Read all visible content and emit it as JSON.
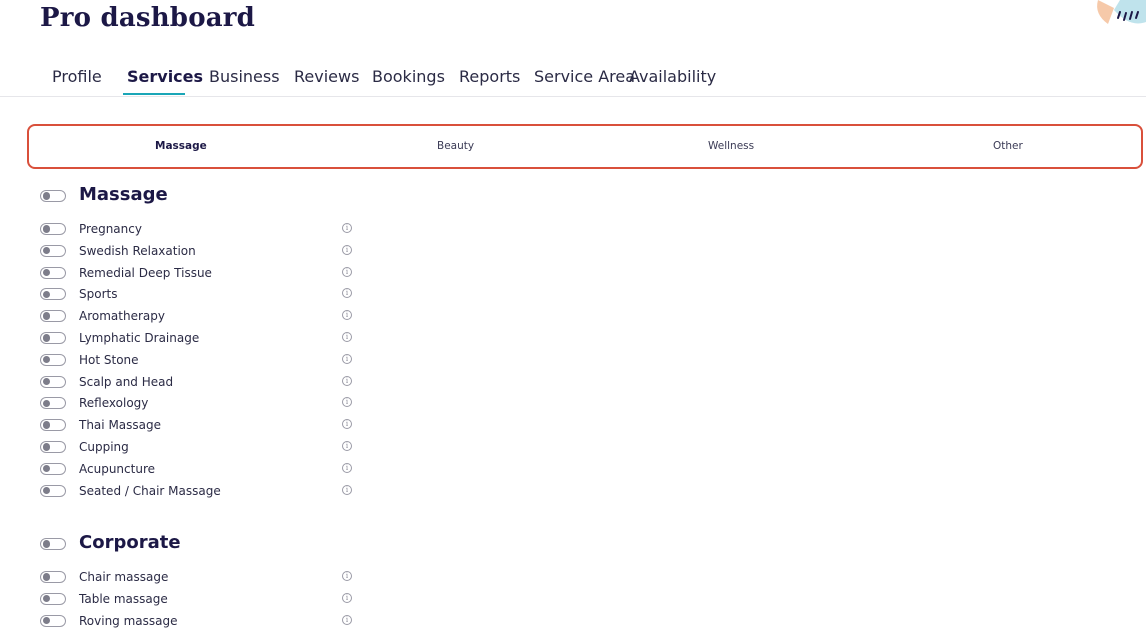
{
  "header": {
    "title": "Pro dashboard"
  },
  "nav": {
    "tabs": [
      {
        "label": "Profile"
      },
      {
        "label": "Services"
      },
      {
        "label": "Business"
      },
      {
        "label": "Reviews"
      },
      {
        "label": "Bookings"
      },
      {
        "label": "Reports"
      },
      {
        "label": "Service Area"
      },
      {
        "label": "Availability"
      }
    ],
    "active": "Services"
  },
  "categories": {
    "tabs": [
      {
        "label": "Massage"
      },
      {
        "label": "Beauty"
      },
      {
        "label": "Wellness"
      },
      {
        "label": "Other"
      }
    ],
    "active": "Massage",
    "highlight_color": "#d9503b"
  },
  "sections": [
    {
      "heading": "Massage",
      "enabled": false,
      "services": [
        {
          "label": "Pregnancy",
          "enabled": false,
          "info_icon": "info-icon"
        },
        {
          "label": "Swedish Relaxation",
          "enabled": false,
          "info_icon": "info-icon"
        },
        {
          "label": "Remedial Deep Tissue",
          "enabled": false,
          "info_icon": "info-icon"
        },
        {
          "label": "Sports",
          "enabled": false,
          "info_icon": "info-icon"
        },
        {
          "label": "Aromatherapy",
          "enabled": false,
          "info_icon": "info-icon"
        },
        {
          "label": "Lymphatic Drainage",
          "enabled": false,
          "info_icon": "info-icon"
        },
        {
          "label": "Hot Stone",
          "enabled": false,
          "info_icon": "info-icon"
        },
        {
          "label": "Scalp and Head",
          "enabled": false,
          "info_icon": "info-icon"
        },
        {
          "label": "Reflexology",
          "enabled": false,
          "info_icon": "info-icon"
        },
        {
          "label": "Thai Massage",
          "enabled": false,
          "info_icon": "info-icon"
        },
        {
          "label": "Cupping",
          "enabled": false,
          "info_icon": "info-icon"
        },
        {
          "label": "Acupuncture",
          "enabled": false,
          "info_icon": "info-icon"
        },
        {
          "label": "Seated / Chair Massage",
          "enabled": false,
          "info_icon": "info-icon"
        }
      ]
    },
    {
      "heading": "Corporate",
      "enabled": false,
      "services": [
        {
          "label": "Chair massage",
          "enabled": false,
          "info_icon": "info-icon"
        },
        {
          "label": "Table massage",
          "enabled": false,
          "info_icon": "info-icon"
        },
        {
          "label": "Roving massage",
          "enabled": false,
          "info_icon": "info-icon"
        }
      ]
    }
  ],
  "colors": {
    "title": "#1c1846",
    "nav_underline": "#1aa6b7",
    "text": "#2b2b45"
  },
  "info_glyph": "i"
}
